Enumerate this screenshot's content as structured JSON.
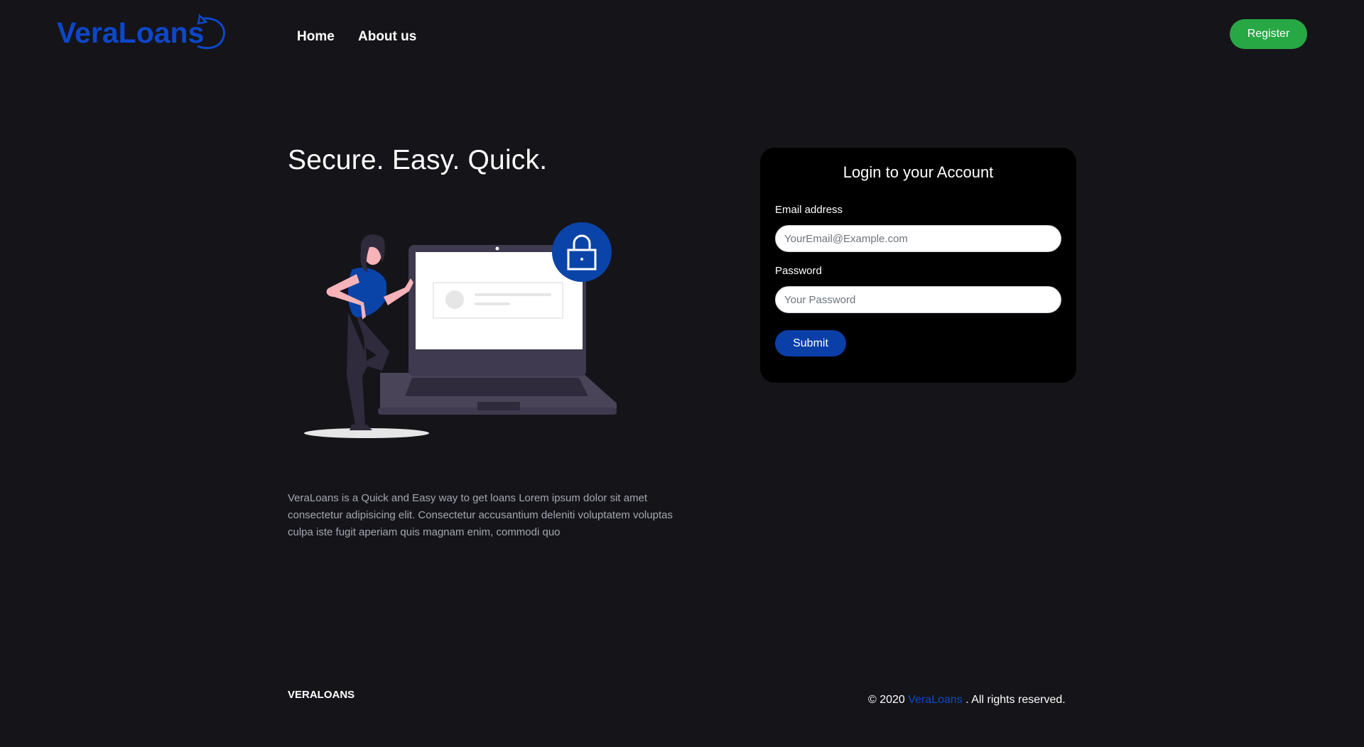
{
  "navbar": {
    "logo_text": "VeraLoans",
    "links": [
      "Home",
      "About us"
    ],
    "register_label": "Register"
  },
  "hero": {
    "title": "Secure. Easy. Quick.",
    "description": "VeraLoans is a Quick and Easy way to get loans Lorem ipsum dolor sit amet consectetur adipisicing elit. Consectetur accusantium deleniti voluptatem voluptas culpa iste fugit aperiam quis magnam enim, commodi quo"
  },
  "login": {
    "title": "Login to your Account",
    "email_label": "Email address",
    "email_placeholder": "YourEmail@Example.com",
    "password_label": "Password",
    "password_placeholder": "Your Password",
    "submit_label": "Submit"
  },
  "footer": {
    "brand": "VERALOANS",
    "copyright_prefix": "© 2020",
    "copyright_link": "VeraLoans",
    "copyright_suffix": ". All rights reserved."
  },
  "colors": {
    "background": "#151419",
    "brand_blue": "#0d47c9",
    "register_green": "#28a745",
    "submit_blue": "#0a3fa8",
    "card": "#000000"
  },
  "icons": [
    "veraloans-logo",
    "lock-icon"
  ]
}
